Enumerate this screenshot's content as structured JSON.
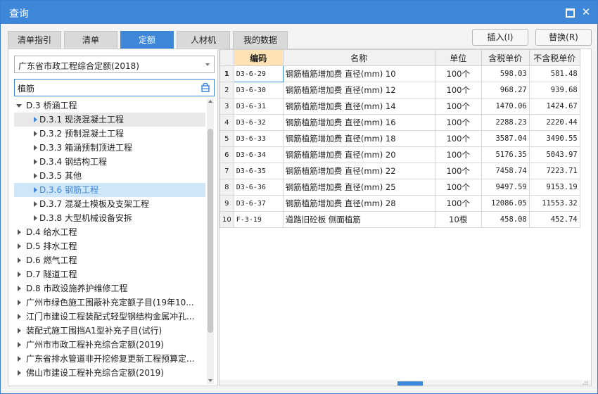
{
  "window": {
    "title": "查询"
  },
  "tabs": [
    "清单指引",
    "清单",
    "定额",
    "人材机",
    "我的数据"
  ],
  "active_tab": "定额",
  "actions": {
    "insert": "插入(I)",
    "replace": "替换(R)"
  },
  "library": {
    "selected": "广东省市政工程综合定额(2018)"
  },
  "search": {
    "value": "植筋"
  },
  "tree": [
    {
      "label": "D.3 桥涵工程",
      "expanded": true
    },
    {
      "label": "D.3.1 现浇混凝土工程"
    },
    {
      "label": "D.3.2 预制混凝土工程"
    },
    {
      "label": "D.3.3 箱涵预制顶进工程"
    },
    {
      "label": "D.3.4 钢结构工程"
    },
    {
      "label": "D.3.5 其他"
    },
    {
      "label": "D.3.6 钢筋工程",
      "selected": true
    },
    {
      "label": "D.3.7 混凝土模板及支架工程"
    },
    {
      "label": "D.3.8 大型机械设备安拆"
    },
    {
      "label": "D.4 给水工程"
    },
    {
      "label": "D.5 排水工程"
    },
    {
      "label": "D.6 燃气工程"
    },
    {
      "label": "D.7 隧道工程"
    },
    {
      "label": "D.8 市政设施养护维修工程"
    },
    {
      "label": "广州市绿色施工围蔽补充定额子目(19年10..."
    },
    {
      "label": "江门市建设工程装配式轻型钢结构金属冲孔..."
    },
    {
      "label": "装配式施工围挡A1型补充子目(试行)"
    },
    {
      "label": "广州市市政工程补充综合定额(2019)"
    },
    {
      "label": "广东省排水管道非开挖修复更新工程预算定..."
    },
    {
      "label": "佛山市建设工程补充综合定额(2019)"
    }
  ],
  "table": {
    "headers": [
      "编码",
      "名称",
      "单位",
      "含税单价",
      "不含税单价"
    ],
    "rows": [
      {
        "n": "1",
        "code": "D3-6-29",
        "name": "钢筋植筋增加费 直径(mm) 10",
        "unit": "100个",
        "tax_price": "598.03",
        "notax_price": "581.48"
      },
      {
        "n": "2",
        "code": "D3-6-30",
        "name": "钢筋植筋增加费 直径(mm) 12",
        "unit": "100个",
        "tax_price": "968.27",
        "notax_price": "939.68"
      },
      {
        "n": "3",
        "code": "D3-6-31",
        "name": "钢筋植筋增加费 直径(mm) 14",
        "unit": "100个",
        "tax_price": "1470.06",
        "notax_price": "1424.67"
      },
      {
        "n": "4",
        "code": "D3-6-32",
        "name": "钢筋植筋增加费 直径(mm) 16",
        "unit": "100个",
        "tax_price": "2288.23",
        "notax_price": "2220.44"
      },
      {
        "n": "5",
        "code": "D3-6-33",
        "name": "钢筋植筋增加费 直径(mm) 18",
        "unit": "100个",
        "tax_price": "3587.04",
        "notax_price": "3490.55"
      },
      {
        "n": "6",
        "code": "D3-6-34",
        "name": "钢筋植筋增加费 直径(mm) 20",
        "unit": "100个",
        "tax_price": "5176.35",
        "notax_price": "5043.97"
      },
      {
        "n": "7",
        "code": "D3-6-35",
        "name": "钢筋植筋增加费 直径(mm) 22",
        "unit": "100个",
        "tax_price": "7458.74",
        "notax_price": "7223.71"
      },
      {
        "n": "8",
        "code": "D3-6-36",
        "name": "钢筋植筋增加费 直径(mm) 25",
        "unit": "100个",
        "tax_price": "9497.59",
        "notax_price": "9153.19"
      },
      {
        "n": "9",
        "code": "D3-6-37",
        "name": "钢筋植筋增加费 直径(mm) 28",
        "unit": "100个",
        "tax_price": "12086.05",
        "notax_price": "11553.32"
      },
      {
        "n": "10",
        "code": "F-3-19",
        "name": "道路旧砼板 侧面植筋",
        "unit": "10根",
        "tax_price": "458.08",
        "notax_price": "452.74"
      }
    ]
  },
  "colors": {
    "accent": "#3d86d8",
    "header_highlight": "#ffe3b4",
    "selected_row": "#cfe5f8"
  },
  "icons": [
    "maximize-icon",
    "close-icon",
    "dropdown-arrow-icon",
    "search-icon",
    "caret-down-icon",
    "caret-right-icon"
  ]
}
